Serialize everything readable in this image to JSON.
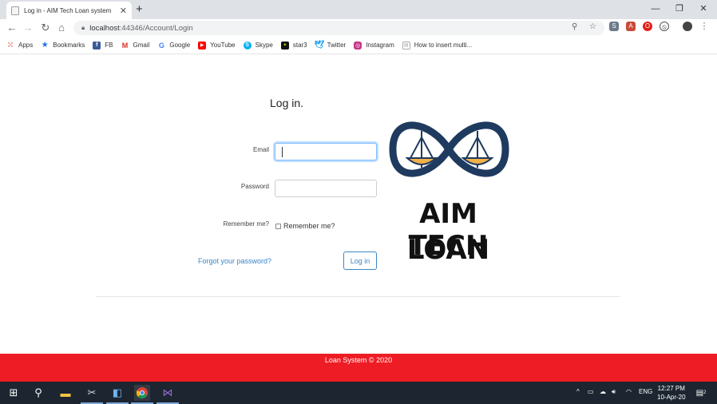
{
  "browser": {
    "tab_title": "Log in - AIM Tech Loan system",
    "tab_close": "✕",
    "new_tab": "+",
    "url_host": "localhost",
    "url_rest": ":44346/Account/Login",
    "window_minimize": "—",
    "window_restore": "❐",
    "window_close": "✕"
  },
  "bookmarks": [
    {
      "label": "Apps",
      "icon": "apps-grid-icon"
    },
    {
      "label": "Bookmarks",
      "icon": "star-icon"
    },
    {
      "label": "FB",
      "icon": "facebook-icon"
    },
    {
      "label": "Gmail",
      "icon": "gmail-icon"
    },
    {
      "label": "Google",
      "icon": "google-icon"
    },
    {
      "label": "YouTube",
      "icon": "youtube-icon"
    },
    {
      "label": "Skype",
      "icon": "skype-icon"
    },
    {
      "label": "star3",
      "icon": "star3-icon"
    },
    {
      "label": "Twitter",
      "icon": "twitter-icon"
    },
    {
      "label": "Instagram",
      "icon": "instagram-icon"
    },
    {
      "label": "How to insert multi...",
      "icon": "page-icon"
    }
  ],
  "login": {
    "heading": "Log in.",
    "email_label": "Email",
    "email_value": "",
    "password_label": "Password",
    "password_value": "",
    "remember_label": "Remember me?",
    "remember_checkbox_label": "Remember me?",
    "remember_checked": false,
    "forgot_link": "Forgot your password?",
    "submit_label": "Log in"
  },
  "logo": {
    "line1": "AIM TECH",
    "line2": "LOAN",
    "ring_color": "#1f3a5f",
    "scale_color": "#f2b248"
  },
  "footer": {
    "text": "Loan System © 2020",
    "color": "#ee1c24"
  },
  "taskbar": {
    "language": "ENG",
    "time": "12:27 PM",
    "date": "10-Apr-20",
    "notification_count": "2"
  }
}
